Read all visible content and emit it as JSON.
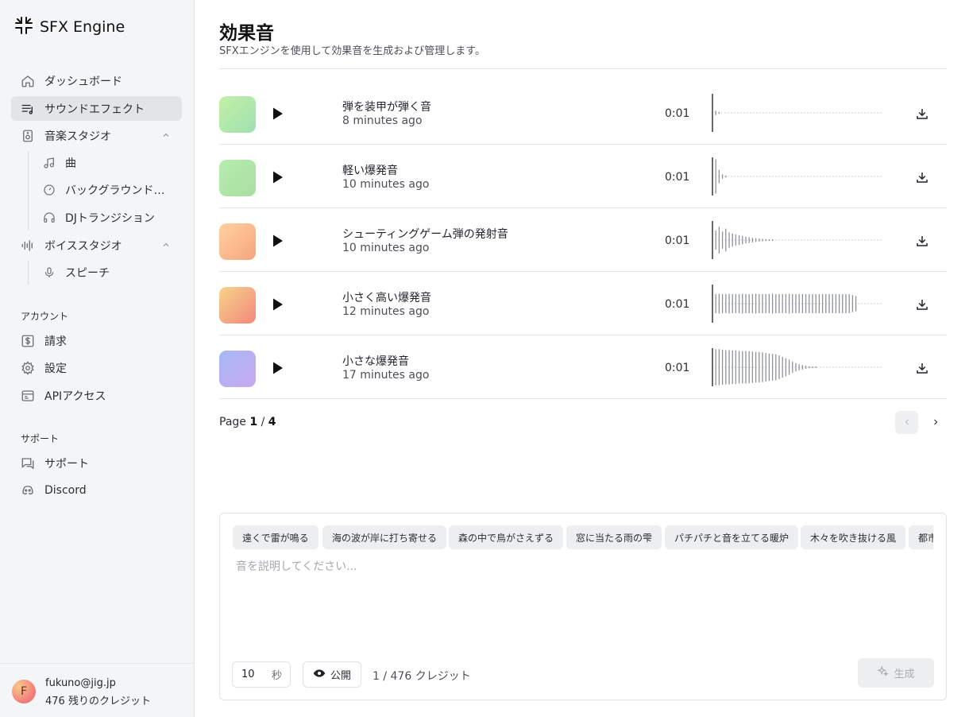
{
  "app": {
    "name": "SFX Engine"
  },
  "sidebar": {
    "nav": [
      {
        "label": "ダッシュボード",
        "icon": "home-icon"
      },
      {
        "label": "サウンドエフェクト",
        "icon": "sound-effects-icon",
        "active": true
      },
      {
        "label": "音楽スタジオ",
        "icon": "music-studio-icon",
        "expanded": true
      }
    ],
    "music_sub": [
      {
        "label": "曲",
        "icon": "music-note-icon"
      },
      {
        "label": "バックグラウンドミュージック",
        "icon": "disc-icon"
      },
      {
        "label": "DJトランジション",
        "icon": "headphones-icon"
      }
    ],
    "voice": {
      "label": "ボイススタジオ",
      "icon": "voice-wave-icon",
      "expanded": true
    },
    "voice_sub": [
      {
        "label": "スピーチ",
        "icon": "microphone-icon"
      }
    ],
    "account_label": "アカウント",
    "account": [
      {
        "label": "請求",
        "icon": "billing-icon"
      },
      {
        "label": "設定",
        "icon": "gear-icon"
      },
      {
        "label": "APIアクセス",
        "icon": "api-window-icon"
      }
    ],
    "support_label": "サポート",
    "support": [
      {
        "label": "サポート",
        "icon": "chat-icon"
      },
      {
        "label": "Discord",
        "icon": "discord-icon"
      }
    ],
    "user": {
      "initial": "F",
      "email": "fukuno@jig.jp",
      "credits": "476 残りのクレジット"
    }
  },
  "main": {
    "title": "効果音",
    "subtitle": "SFXエンジンを使用して効果音を生成および管理します。",
    "items": [
      {
        "title": "弾を装甲が弾く音",
        "time": "8 minutes ago",
        "duration": "0:01",
        "gradient": [
          "#c3f0a8",
          "#9fe0b0"
        ]
      },
      {
        "title": "軽い爆発音",
        "time": "10 minutes ago",
        "duration": "0:01",
        "gradient": [
          "#b6eeb0",
          "#a8dfa0"
        ]
      },
      {
        "title": "シューティングゲーム弾の発射音",
        "time": "10 minutes ago",
        "duration": "0:01",
        "gradient": [
          "#ffd0a0",
          "#f6a57e"
        ]
      },
      {
        "title": "小さく高い爆発音",
        "time": "12 minutes ago",
        "duration": "0:01",
        "gradient": [
          "#f5d48a",
          "#f4877a"
        ]
      },
      {
        "title": "小さな爆発音",
        "time": "17 minutes ago",
        "duration": "0:01",
        "gradient": [
          "#a5b8f5",
          "#c9a7f0"
        ]
      }
    ],
    "pagination": {
      "prefix": "Page",
      "current": "1",
      "separator": "/",
      "total": "4"
    }
  },
  "composer": {
    "suggestions": [
      "遠くで雷が鳴る",
      "海の波が岸に打ち寄せる",
      "森の中で鳥がさえずる",
      "窓に当たる雨の雫",
      "パチパチと音を立てる暖炉",
      "木々を吹き抜ける風",
      "都市"
    ],
    "placeholder": "音を説明してください...",
    "seconds_value": "10",
    "seconds_unit": "秒",
    "public_label": "公開",
    "credit_count": "1 / 476 クレジット",
    "generate_label": "生成"
  }
}
